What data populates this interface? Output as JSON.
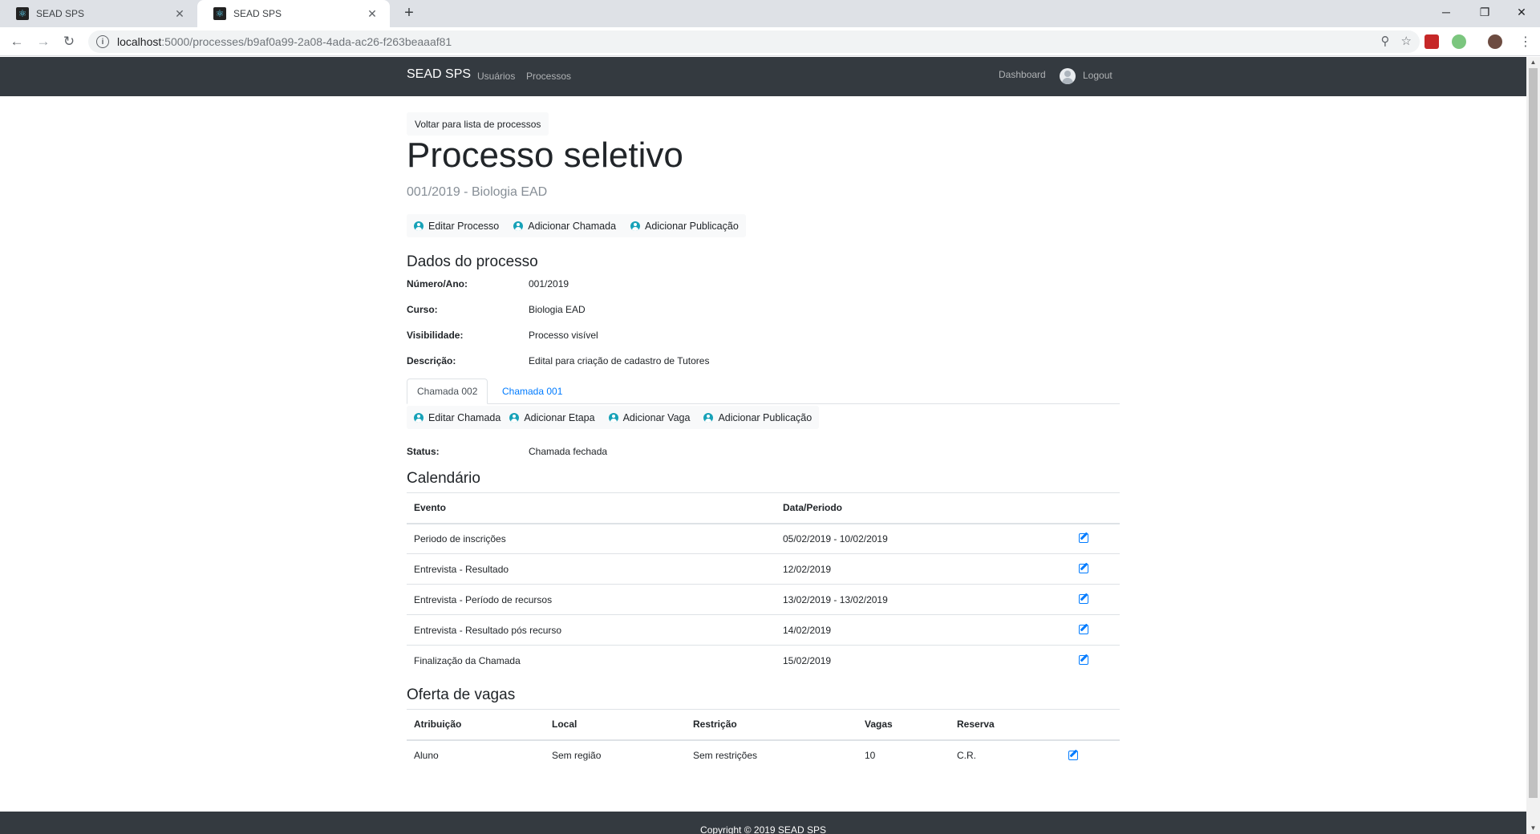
{
  "browser": {
    "tabs": [
      {
        "title": "SEAD SPS"
      },
      {
        "title": "SEAD SPS"
      }
    ],
    "url_host": "localhost",
    "url_path": ":5000/processes/b9af0a99-2a08-4ada-ac26-f263beaaaf81"
  },
  "navbar": {
    "brand": "SEAD SPS",
    "links": [
      "Usuários",
      "Processos"
    ],
    "dashboard": "Dashboard",
    "logout": "Logout"
  },
  "page": {
    "back_button": "Voltar para lista de processos",
    "title": "Processo seletivo",
    "subtitle": "001/2019 - Biologia EAD",
    "process_actions": [
      "Editar Processo",
      "Adicionar Chamada",
      "Adicionar Publicação"
    ],
    "details_heading": "Dados do processo",
    "details": [
      {
        "label": "Número/Ano:",
        "value": "001/2019"
      },
      {
        "label": "Curso:",
        "value": "Biologia EAD"
      },
      {
        "label": "Visibilidade:",
        "value": "Processo visível"
      },
      {
        "label": "Descrição:",
        "value": "Edital para criação de cadastro de Tutores"
      }
    ],
    "call_tabs": [
      "Chamada 002",
      "Chamada 001"
    ],
    "call_actions": [
      "Editar Chamada",
      "Adicionar Etapa",
      "Adicionar Vaga",
      "Adicionar Publicação"
    ],
    "status_label": "Status:",
    "status_value": "Chamada fechada",
    "calendar_heading": "Calendário",
    "calendar_headers": [
      "Evento",
      "Data/Periodo"
    ],
    "calendar_rows": [
      {
        "event": "Periodo de inscrições",
        "date": "05/02/2019 - 10/02/2019"
      },
      {
        "event": "Entrevista - Resultado",
        "date": "12/02/2019"
      },
      {
        "event": "Entrevista - Período de recursos",
        "date": "13/02/2019 - 13/02/2019"
      },
      {
        "event": "Entrevista - Resultado pós recurso",
        "date": "14/02/2019"
      },
      {
        "event": "Finalização da Chamada",
        "date": "15/02/2019"
      }
    ],
    "vacancies_heading": "Oferta de vagas",
    "vacancies_headers": [
      "Atribuição",
      "Local",
      "Restrição",
      "Vagas",
      "Reserva"
    ],
    "vacancies_rows": [
      {
        "role": "Aluno",
        "place": "Sem região",
        "restriction": "Sem restrições",
        "slots": "10",
        "reserve": "C.R."
      }
    ]
  },
  "footer": {
    "text": "Copyright © 2019 SEAD SPS"
  }
}
